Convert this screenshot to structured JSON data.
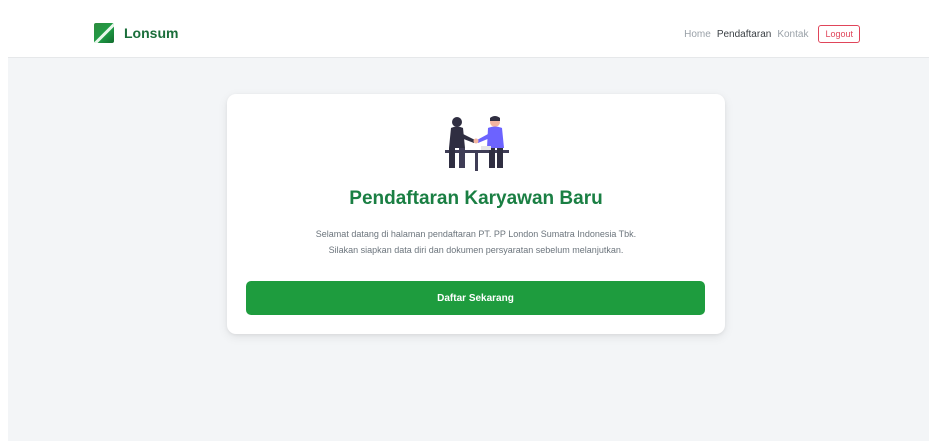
{
  "navbar": {
    "brand": "Lonsum",
    "links": [
      "Home",
      "Pendaftaran",
      "Kontak"
    ],
    "active_index": 1,
    "logout_label": "Logout"
  },
  "card": {
    "illustration": "handshake-illustration",
    "title": "Pendaftaran Karyawan Baru",
    "description_line1": "Selamat datang di halaman pendaftaran PT. PP London Sumatra Indonesia Tbk.",
    "description_line2": "Silakan siapkan data diri dan dokumen persyaratan sebelum melanjutkan.",
    "cta_label": "Daftar Sekarang"
  },
  "colors": {
    "brand_green": "#1a7f43",
    "button_green": "#1e9c3e",
    "logout_red": "#e0455a",
    "page_bg": "#f3f5f7"
  }
}
